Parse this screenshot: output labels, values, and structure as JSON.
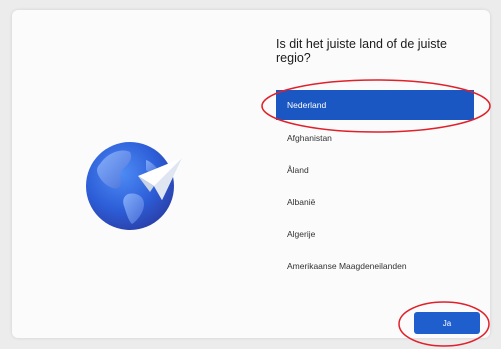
{
  "setup": {
    "question": "Is dit het juiste land of de juiste regio?",
    "regions": [
      {
        "label": "Nederland",
        "selected": true
      },
      {
        "label": "Afghanistan",
        "selected": false
      },
      {
        "label": "Åland",
        "selected": false
      },
      {
        "label": "Albanië",
        "selected": false
      },
      {
        "label": "Algerije",
        "selected": false
      },
      {
        "label": "Amerikaanse Maagdeneilanden",
        "selected": false
      }
    ],
    "next_label": "Ja"
  },
  "colors": {
    "accent": "#1a57c2",
    "annotation": "#e0202a"
  },
  "icons": {
    "illustration": "globe-with-paper-plane-icon"
  }
}
